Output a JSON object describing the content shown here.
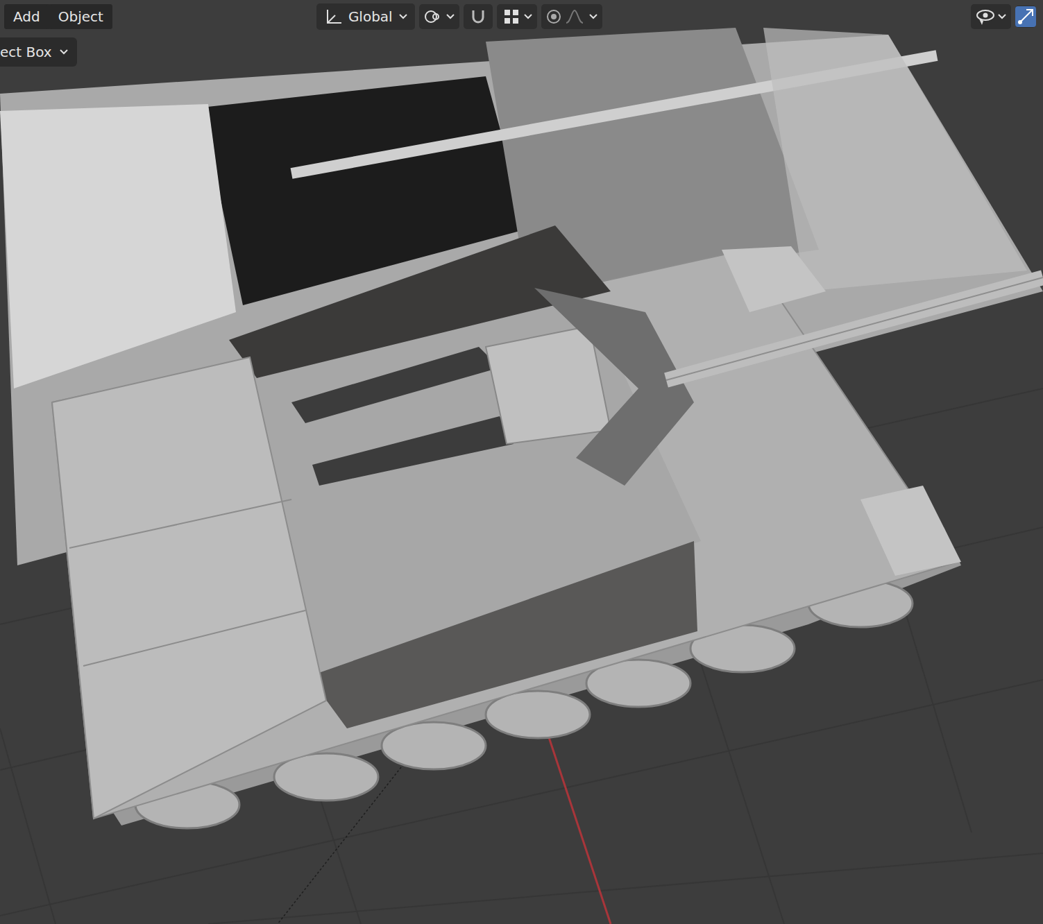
{
  "menus": [
    {
      "label": "Add"
    },
    {
      "label": "Object"
    }
  ],
  "tool_dropdown": {
    "label": "ect Box"
  },
  "orientation": {
    "label": "Global"
  },
  "toolbar_buttons": [
    {
      "kind": "pivot",
      "active": false
    },
    {
      "kind": "snap",
      "active": false
    },
    {
      "kind": "snap-target",
      "active": false
    },
    {
      "kind": "proportional",
      "active": false
    }
  ],
  "right_buttons": [
    {
      "kind": "visibility",
      "active": false
    },
    {
      "kind": "gizmo",
      "active": true
    }
  ]
}
